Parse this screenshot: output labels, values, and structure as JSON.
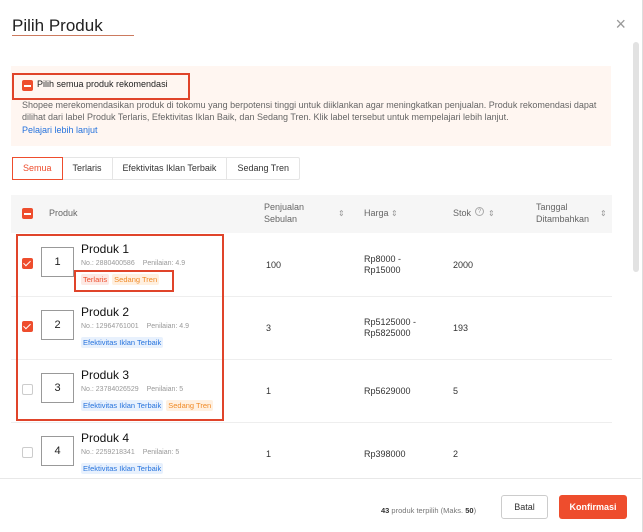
{
  "modal": {
    "title": "Pilih Produk",
    "close": "×"
  },
  "recommendation": {
    "select_all_label": "Pilih semua produk rekomendasi",
    "description": "Shopee merekomendasikan produk di tokomu yang berpotensi tinggi untuk diiklankan agar meningkatkan penjualan. Produk rekomendasi dapat dilihat dari label Produk Terlaris, Efektivitas Iklan Baik, dan Sedang Tren. Klik label tersebut untuk mempelajari lebih lanjut.",
    "learn_more": "Pelajari lebih lanjut"
  },
  "tabs": [
    {
      "label": "Semua",
      "active": true
    },
    {
      "label": "Terlaris",
      "active": false
    },
    {
      "label": "Efektivitas Iklan Terbaik",
      "active": false
    },
    {
      "label": "Sedang Tren",
      "active": false
    }
  ],
  "table": {
    "headers": {
      "product": "Produk",
      "sales_l1": "Penjualan",
      "sales_l2": "Sebulan",
      "price": "Harga",
      "stock": "Stok",
      "date_l1": "Tanggal",
      "date_l2": "Ditambahkan"
    },
    "sort_icon": "⇕",
    "rows": [
      {
        "num": "1",
        "name": "Produk 1",
        "no": "No.: 2880400586",
        "rating": "Penilaian: 4.9",
        "tags": [
          {
            "text": "Terlaris",
            "kind": "terlaris"
          },
          {
            "text": "Sedang Tren",
            "kind": "tren"
          }
        ],
        "sales": "100",
        "price_l1": "Rp8000 -",
        "price_l2": "Rp15000",
        "stock": "2000",
        "checked": true
      },
      {
        "num": "2",
        "name": "Produk 2",
        "no": "No.: 12964761001",
        "rating": "Penilaian: 4.9",
        "tags": [
          {
            "text": "Efektivitas Iklan Terbaik",
            "kind": "efek"
          }
        ],
        "sales": "3",
        "price_l1": "Rp5125000 -",
        "price_l2": "Rp5825000",
        "stock": "193",
        "checked": true
      },
      {
        "num": "3",
        "name": "Produk 3",
        "no": "No.: 23784026529",
        "rating": "Penilaian: 5",
        "tags": [
          {
            "text": "Efektivitas Iklan Terbaik",
            "kind": "efek"
          },
          {
            "text": "Sedang Tren",
            "kind": "tren"
          }
        ],
        "sales": "1",
        "price_l1": "Rp5629000",
        "price_l2": "",
        "stock": "5",
        "checked": false
      },
      {
        "num": "4",
        "name": "Produk 4",
        "no": "No.: 2259218341",
        "rating": "Penilaian: 5",
        "tags": [
          {
            "text": "Efektivitas Iklan Terbaik",
            "kind": "efek"
          }
        ],
        "sales": "1",
        "price_l1": "Rp398000",
        "price_l2": "",
        "stock": "2",
        "checked": false
      }
    ]
  },
  "footer": {
    "selected_count": "43",
    "selected_text": " produk terpilih (Maks. ",
    "max": "50",
    "close_paren": ")",
    "cancel": "Batal",
    "confirm": "Konfirmasi"
  },
  "colors": {
    "accent": "#ee4d2d",
    "link": "#2673dd",
    "highlight": "#e0442a"
  }
}
